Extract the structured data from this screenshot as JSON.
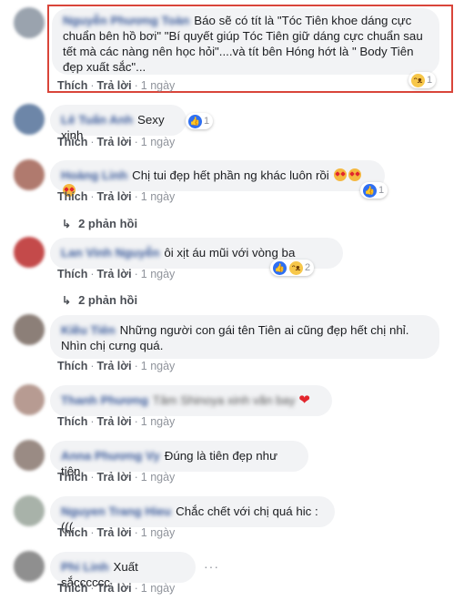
{
  "common": {
    "like": "Thích",
    "reply": "Trả lời",
    "sep": "·"
  },
  "comments": [
    {
      "name": "Nguyễn Phương Toàn",
      "text": "Báo sẽ có tít là \"Tóc Tiên khoe dáng cực chuẩn bên hồ bơi\" \"Bí quyết giúp Tóc Tiên giữ dáng cực chuẩn sau tết mà các nàng nên học hỏi\"....và tít bên Hóng hớt là \" Body Tiên đẹp xuất sắc\"...",
      "time": "1 ngày",
      "reaction_count": "1",
      "reactions": [
        "haha-icon"
      ],
      "avatar_color": "#9aa3ae"
    },
    {
      "name": "Lê Tuấn Anh",
      "text": "Sexy xinh",
      "time": "1 ngày",
      "reaction_count": "1",
      "reactions": [
        "like-icon"
      ],
      "avatar_color": "#6d86a8"
    },
    {
      "name": "Hoàng Linh",
      "text": "Chị tui đẹp hết phần ng khác luôn rồi",
      "time": "1 ngày",
      "reaction_count": "1",
      "reactions": [
        "like-icon"
      ],
      "replies": "2 phản hồi",
      "avatar_color": "#b07a6e"
    },
    {
      "name": "Lan Vinh Nguyễn",
      "text": "ôi xịt áu mũi với vòng ba",
      "time": "1 ngày",
      "reaction_count": "2",
      "reactions": [
        "like-icon",
        "haha-icon"
      ],
      "replies": "2 phản hồi",
      "avatar_color": "#c44a4a"
    },
    {
      "name": "Kiều Tiên",
      "text": "Những người con gái tên Tiên ai cũng đẹp hết chị nhỉ. Nhìn chị cưng quá.",
      "time": "1 ngày",
      "avatar_color": "#8c7f78"
    },
    {
      "name": "Thanh Phương",
      "text": "Tâm Shinoya xinh vãn bay",
      "time": "1 ngày",
      "avatar_color": "#b79b92"
    },
    {
      "name": "Anna Phương Vy",
      "text": "Đúng là tiên đẹp như tiên",
      "time": "1 ngày",
      "avatar_color": "#9a8b84"
    },
    {
      "name": "Nguyen Trang Hieu",
      "text": "Chắc chết với chị quá hic :(((",
      "time": "1 ngày",
      "avatar_color": "#a8b2a9"
    },
    {
      "name": "Phi Linh",
      "text": "Xuất sắcccccc",
      "time": "1 ngày",
      "avatar_color": "#8f8f8f"
    }
  ]
}
